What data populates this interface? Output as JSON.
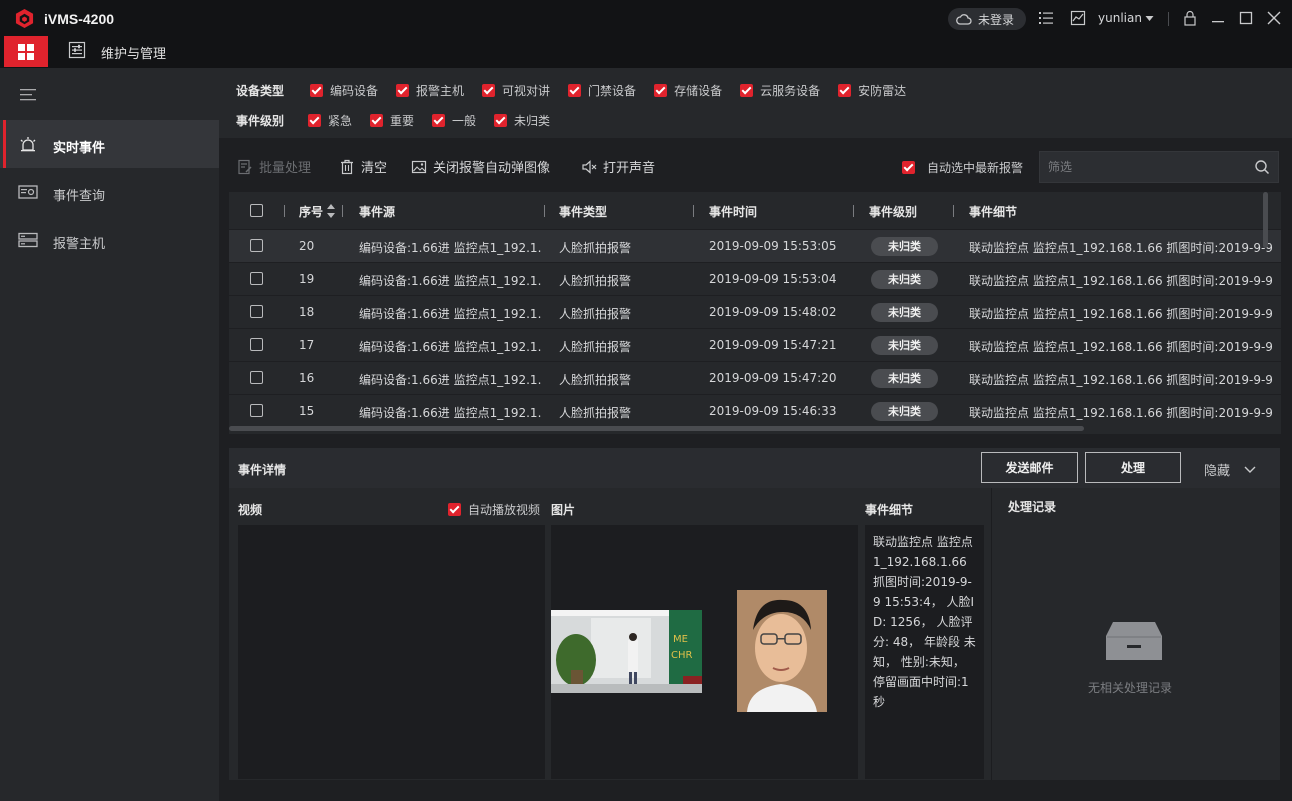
{
  "app": {
    "title": "iVMS-4200"
  },
  "titlebar": {
    "login_status": "未登录",
    "user": "yunlian"
  },
  "menubar": {
    "maintenance_label": "维护与管理"
  },
  "sidebar": {
    "items": [
      {
        "label": "实时事件",
        "icon": "alarm-light-icon",
        "active": true
      },
      {
        "label": "事件查询",
        "icon": "event-search-icon",
        "active": false
      },
      {
        "label": "报警主机",
        "icon": "alarm-host-icon",
        "active": false
      }
    ]
  },
  "filters": {
    "device_type_label": "设备类型",
    "device_types": [
      "编码设备",
      "报警主机",
      "可视对讲",
      "门禁设备",
      "存储设备",
      "云服务设备",
      "安防雷达"
    ],
    "event_level_label": "事件级别",
    "event_levels": [
      "紧急",
      "重要",
      "一般",
      "未归类"
    ]
  },
  "toolbar": {
    "batch_label": "批量处理",
    "clear_label": "清空",
    "close_popup_label": "关闭报警自动弹图像",
    "sound_label": "打开声音",
    "auto_select_label": "自动选中最新报警",
    "search_placeholder": "筛选"
  },
  "table": {
    "headers": [
      "序号",
      "事件源",
      "事件类型",
      "事件时间",
      "事件级别",
      "事件细节"
    ],
    "rows": [
      {
        "seq": "20",
        "source": "编码设备:1.66进 监控点1_192.1...",
        "type": "人脸抓拍报警",
        "time": "2019-09-09 15:53:05",
        "level": "未归类",
        "detail": "联动监控点 监控点1_192.168.1.66 抓图时间:2019-9-9"
      },
      {
        "seq": "19",
        "source": "编码设备:1.66进 监控点1_192.1...",
        "type": "人脸抓拍报警",
        "time": "2019-09-09 15:53:04",
        "level": "未归类",
        "detail": "联动监控点 监控点1_192.168.1.66 抓图时间:2019-9-9"
      },
      {
        "seq": "18",
        "source": "编码设备:1.66进 监控点1_192.1...",
        "type": "人脸抓拍报警",
        "time": "2019-09-09 15:48:02",
        "level": "未归类",
        "detail": "联动监控点 监控点1_192.168.1.66 抓图时间:2019-9-9"
      },
      {
        "seq": "17",
        "source": "编码设备:1.66进 监控点1_192.1...",
        "type": "人脸抓拍报警",
        "time": "2019-09-09 15:47:21",
        "level": "未归类",
        "detail": "联动监控点 监控点1_192.168.1.66 抓图时间:2019-9-9"
      },
      {
        "seq": "16",
        "source": "编码设备:1.66进 监控点1_192.1...",
        "type": "人脸抓拍报警",
        "time": "2019-09-09 15:47:20",
        "level": "未归类",
        "detail": "联动监控点 监控点1_192.168.1.66 抓图时间:2019-9-9"
      },
      {
        "seq": "15",
        "source": "编码设备:1.66进 监控点1_192.1...",
        "type": "人脸抓拍报警",
        "time": "2019-09-09 15:46:33",
        "level": "未归类",
        "detail": "联动监控点 监控点1_192.168.1.66 抓图时间:2019-9-9"
      }
    ]
  },
  "details": {
    "title": "事件详情",
    "send_mail_label": "发送邮件",
    "handle_label": "处理",
    "hide_label": "隐藏",
    "video_label": "视频",
    "autoplay_label": "自动播放视频",
    "image_label": "图片",
    "event_detail_label": "事件细节",
    "event_detail_text": "联动监控点 监控点1_192.168.1.66 抓图时间:2019-9-9 15:53:4， 人脸ID: 1256， 人脸评分: 48， 年龄段 未知， 性别:未知， 停留画面中时间:1秒",
    "records_label": "处理记录",
    "no_records_text": "无相关处理记录"
  },
  "colors": {
    "accent": "#e0232d",
    "background": "#1e1f22",
    "panel": "#26282b"
  }
}
